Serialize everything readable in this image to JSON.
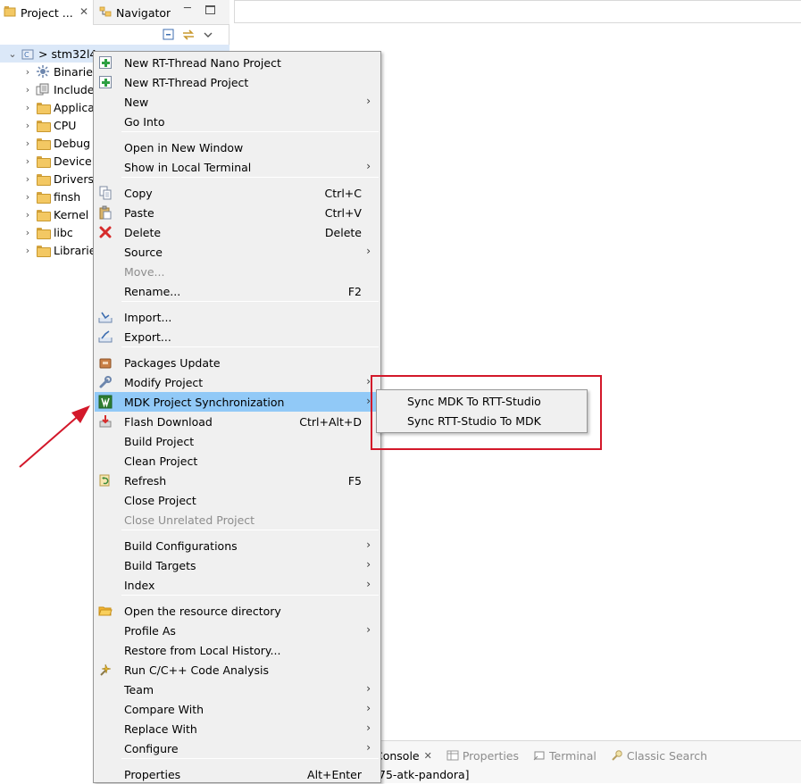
{
  "left_panel": {
    "tabs": [
      {
        "label": "Project ..."
      },
      {
        "label": "Navigator"
      }
    ],
    "tree": {
      "root_label": "> stm32l4",
      "items": [
        {
          "label": "Binaries",
          "icon": "binaries-icon"
        },
        {
          "label": "Include",
          "icon": "includes-icon"
        },
        {
          "label": "Applica",
          "icon": "folder-icon"
        },
        {
          "label": "CPU",
          "icon": "folder-icon"
        },
        {
          "label": "Debug",
          "icon": "folder-icon"
        },
        {
          "label": "DeviceD",
          "icon": "folder-icon"
        },
        {
          "label": "Drivers",
          "icon": "folder-icon"
        },
        {
          "label": "finsh",
          "icon": "folder-icon"
        },
        {
          "label": "Kernel",
          "icon": "folder-icon"
        },
        {
          "label": "libc",
          "icon": "folder-icon"
        },
        {
          "label": "Librarie",
          "icon": "folder-icon"
        }
      ]
    }
  },
  "bottom_panel": {
    "tabs": [
      {
        "label": "Console"
      },
      {
        "label": "Properties"
      },
      {
        "label": "Terminal"
      },
      {
        "label": "Classic Search"
      }
    ],
    "console_title": "75-atk-pandora]"
  },
  "context_menu": {
    "items": [
      {
        "label": "New RT-Thread Nano Project",
        "accel": "",
        "icon": "new-project-icon"
      },
      {
        "label": "New RT-Thread Project",
        "accel": "",
        "icon": "new-project-icon"
      },
      {
        "label": "New",
        "accel": "",
        "icon": ""
      },
      {
        "label": "Go Into",
        "accel": "",
        "icon": ""
      },
      {
        "label": "Open in New Window",
        "accel": "",
        "icon": ""
      },
      {
        "label": "Show in Local Terminal",
        "accel": "",
        "icon": ""
      },
      {
        "label": "Copy",
        "accel": "Ctrl+C",
        "icon": "copy-icon"
      },
      {
        "label": "Paste",
        "accel": "Ctrl+V",
        "icon": "paste-icon"
      },
      {
        "label": "Delete",
        "accel": "Delete",
        "icon": "delete-icon"
      },
      {
        "label": "Source",
        "accel": "",
        "icon": ""
      },
      {
        "label": "Move...",
        "accel": "",
        "icon": ""
      },
      {
        "label": "Rename...",
        "accel": "F2",
        "icon": ""
      },
      {
        "label": "Import...",
        "accel": "",
        "icon": "import-icon"
      },
      {
        "label": "Export...",
        "accel": "",
        "icon": "export-icon"
      },
      {
        "label": "Packages Update",
        "accel": "",
        "icon": "packages-icon"
      },
      {
        "label": "Modify Project",
        "accel": "",
        "icon": "wrench-icon"
      },
      {
        "label": "MDK Project Synchronization",
        "accel": "",
        "icon": "mdk-icon"
      },
      {
        "label": "Flash Download",
        "accel": "Ctrl+Alt+D",
        "icon": "flash-download-icon"
      },
      {
        "label": "Build Project",
        "accel": "",
        "icon": ""
      },
      {
        "label": "Clean Project",
        "accel": "",
        "icon": ""
      },
      {
        "label": "Refresh",
        "accel": "F5",
        "icon": "refresh-icon"
      },
      {
        "label": "Close Project",
        "accel": "",
        "icon": ""
      },
      {
        "label": "Close Unrelated Project",
        "accel": "",
        "icon": ""
      },
      {
        "label": "Build Configurations",
        "accel": "",
        "icon": ""
      },
      {
        "label": "Build Targets",
        "accel": "",
        "icon": ""
      },
      {
        "label": "Index",
        "accel": "",
        "icon": ""
      },
      {
        "label": "Open the resource directory",
        "accel": "",
        "icon": "open-folder-icon"
      },
      {
        "label": "Profile As",
        "accel": "",
        "icon": ""
      },
      {
        "label": "Restore from Local History...",
        "accel": "",
        "icon": ""
      },
      {
        "label": "Run C/C++ Code Analysis",
        "accel": "",
        "icon": "code-analysis-icon"
      },
      {
        "label": "Team",
        "accel": "",
        "icon": ""
      },
      {
        "label": "Compare With",
        "accel": "",
        "icon": ""
      },
      {
        "label": "Replace With",
        "accel": "",
        "icon": ""
      },
      {
        "label": "Configure",
        "accel": "",
        "icon": ""
      },
      {
        "label": "Properties",
        "accel": "Alt+Enter",
        "icon": ""
      }
    ]
  },
  "submenu": {
    "items": [
      {
        "label": "Sync MDK To RTT-Studio"
      },
      {
        "label": "Sync RTT-Studio To MDK"
      }
    ]
  },
  "colors": {
    "menu_bg": "#f0f0f0",
    "menu_highlight": "#91c9f7",
    "annotation_red": "#d3182a",
    "tree_selection": "#dbe8f8"
  }
}
